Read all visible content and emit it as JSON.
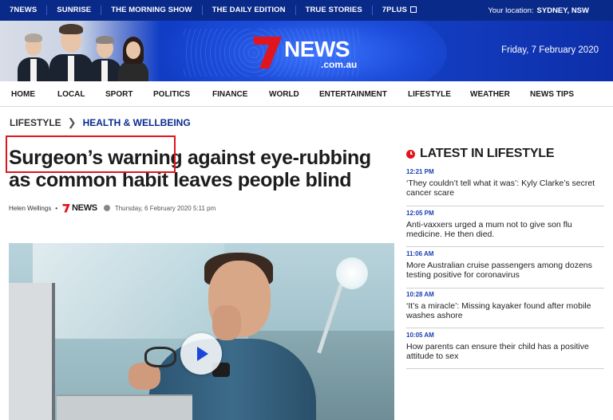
{
  "topbar": {
    "links": [
      "7NEWS",
      "SUNRISE",
      "THE MORNING SHOW",
      "THE DAILY EDITION",
      "TRUE STORIES",
      "7PLUS"
    ],
    "location_label": "Your location:",
    "location_city": "SYDNEY, NSW"
  },
  "banner": {
    "logo_text": "NEWS",
    "logo_domain": ".com.au",
    "date": "Friday, 7 February 2020"
  },
  "nav": {
    "items": [
      "HOME",
      "LOCAL",
      "SPORT",
      "POLITICS",
      "FINANCE",
      "WORLD",
      "ENTERTAINMENT",
      "LIFESTYLE",
      "WEATHER",
      "NEWS TIPS"
    ]
  },
  "breadcrumb": {
    "section": "LIFESTYLE",
    "subsection": "HEALTH & WELLBEING"
  },
  "article": {
    "headline": "Surgeon’s warning against eye-rubbing as common habit leaves people blind",
    "author": "Helen Wellings",
    "brand": "NEWS",
    "timestamp": "Thursday, 6 February 2020 5:11 pm"
  },
  "sidebar": {
    "title": "LATEST IN LIFESTYLE",
    "items": [
      {
        "time": "12:21 PM",
        "headline": "‘They couldn’t tell what it was’: Kyly Clarke’s secret cancer scare"
      },
      {
        "time": "12:05 PM",
        "headline": "Anti-vaxxers urged a mum not to give son flu medicine. He then died."
      },
      {
        "time": "11:06 AM",
        "headline": "More Australian cruise passengers among dozens testing positive for coronavirus"
      },
      {
        "time": "10:28 AM",
        "headline": "‘It’s a miracle’: Missing kayaker found after mobile washes ashore"
      },
      {
        "time": "10:05 AM",
        "headline": "How parents can ensure their child has a positive attitude to sex"
      }
    ]
  },
  "colors": {
    "brand_blue": "#0a2a8a",
    "brand_red": "#e2141c",
    "link_blue": "#1b3fb4"
  }
}
